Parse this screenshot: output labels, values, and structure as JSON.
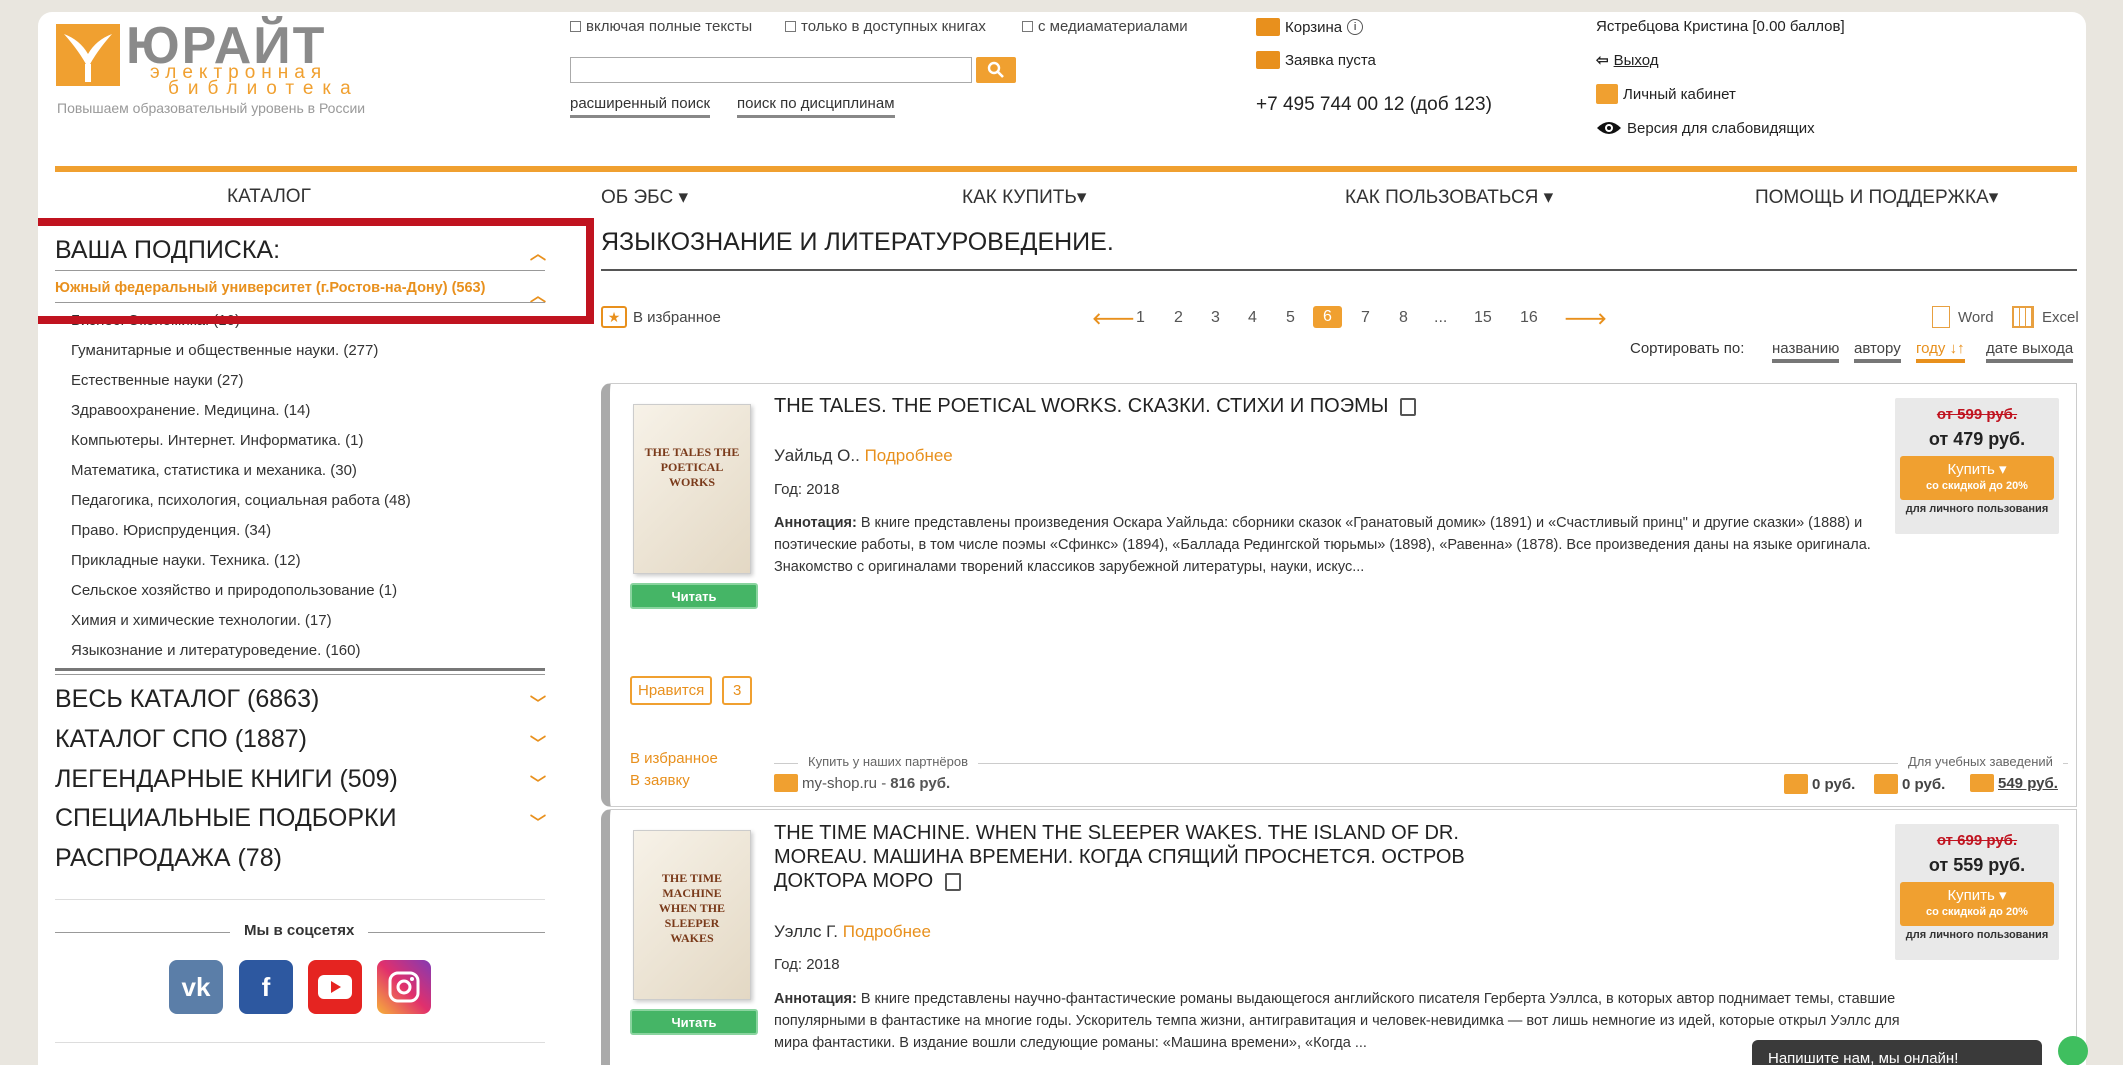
{
  "logo": {
    "main": "ЮРАЙТ",
    "sub1": "электронная",
    "sub2": "библиотека",
    "slogan": "Повышаем образовательный уровень в России"
  },
  "search": {
    "options": [
      "включая полные тексты",
      "только в доступных книгах",
      "с медиаматериалами"
    ],
    "placeholder": "",
    "advanced": "расширенный поиск",
    "by_disciplines": "поиск по дисциплинам"
  },
  "cart": {
    "label": "Корзина",
    "request": "Заявка пуста",
    "phone": "+7 495 744 00 12 (доб 123)"
  },
  "user": {
    "name": "Ястребцова Кристина [0.00 баллов]",
    "logout": "Выход",
    "cabinet": "Личный кабинет",
    "accessibility": "Версия для слабовидящих"
  },
  "nav": [
    "КАТАЛОГ",
    "ОБ ЭБС",
    "КАК КУПИТЬ",
    "КАК ПОЛЬЗОВАТЬСЯ",
    "ПОМОЩЬ И ПОДДЕРЖКА"
  ],
  "sidebar": {
    "subscription_title": "ВАША ПОДПИСКА:",
    "university": "Южный федеральный университет (г.Ростов-на-Дону) (563)",
    "items": [
      "Бизнес. Экономика. (10)",
      "Гуманитарные и общественные науки. (277)",
      "Естественные науки (27)",
      "Здравоохранение. Медицина. (14)",
      "Компьютеры. Интернет. Информатика. (1)",
      "Математика, статистика и механика. (30)",
      "Педагогика, психология, социальная работа (48)",
      "Право. Юриспруденция. (34)",
      "Прикладные науки. Техника. (12)",
      "Сельское хозяйство и природопользование (1)",
      "Химия и химические технологии. (17)",
      "Языкознание и литературоведение. (160)"
    ],
    "sections": [
      "ВЕСЬ КАТАЛОГ (6863)",
      "КАТАЛОГ СПО (1887)",
      "ЛЕГЕНДАРНЫЕ КНИГИ (509)",
      "СПЕЦИАЛЬНЫЕ ПОДБОРКИ",
      "РАСПРОДАЖА (78)"
    ],
    "social_title": "Мы в соцсетях"
  },
  "main": {
    "title": "ЯЗЫКОЗНАНИЕ И ЛИТЕРАТУРОВЕДЕНИЕ.",
    "favorites": "В избранное",
    "pages": [
      "1",
      "2",
      "3",
      "4",
      "5",
      "6",
      "7",
      "8",
      "...",
      "15",
      "16"
    ],
    "active_page": "6",
    "export_word": "Word",
    "export_excel": "Excel",
    "sort_label": "Сортировать по:",
    "sort_options": [
      "названию",
      "автору",
      "году",
      "дате выхода"
    ]
  },
  "books": [
    {
      "title": "THE TALES. THE POETICAL WORKS. СКАЗКИ. СТИХИ И ПОЭМЫ",
      "author": "Уайльд О..",
      "more": "Подробнее",
      "year": "Год: 2018",
      "annot_label": "Аннотация:",
      "annot": "В книге представлены произведения Оскара Уайльда: сборники сказок «Гранатовый домик» (1891) и «Счастливый принц\" и другие сказки» (1888) и поэтические работы, в том числе поэмы «Сфинкс» (1894), «Баллада Редингской тюрьмы» (1898), «Равенна» (1878). Все произведения даны на языке оригинала. Знакомство с оригиналами творений классиков зарубежной литературы, науки, искус...",
      "old_price": "от 599 руб.",
      "price": "от 479 руб.",
      "buy": "Купить ▾",
      "discount": "со скидкой до 20%",
      "personal": "для личного пользования",
      "read": "Читать",
      "like": "Нравится",
      "likes": "3",
      "to_fav": "В избранное",
      "to_request": "В заявку",
      "partners": "Купить у наших партнёров",
      "shop": "my-shop.ru -",
      "shop_price": "816 руб.",
      "institutions": "Для учебных заведений",
      "p1": "0 руб.",
      "p2": "0 руб.",
      "p3": "549 руб.",
      "cover_text": "THE TALES THE POETICAL WORKS"
    },
    {
      "title": "THE TIME MACHINE. WHEN THE SLEEPER WAKES. THE ISLAND OF DR. MOREAU. МАШИНА ВРЕМЕНИ. КОГДА СПЯЩИЙ ПРОСНЕТСЯ. ОСТРОВ ДОКТОРА МОРО",
      "author": "Уэллс Г.",
      "more": "Подробнее",
      "year": "Год: 2018",
      "annot_label": "Аннотация:",
      "annot": "В книге представлены научно-фантастические романы выдающегося английского писателя Герберта Уэллса, в которых автор поднимает темы, ставшие популярными в фантастике на многие годы. Ускоритель темпа жизни, антигравитация и человек-невидимка — вот лишь немногие из идей, которые открыл Уэллс для мира фантастики. В издание вошли следующие романы: «Машина времени», «Когда ...",
      "old_price": "от 699 руб.",
      "price": "от 559 руб.",
      "buy": "Купить ▾",
      "discount": "со скидкой до 20%",
      "personal": "для личного пользования",
      "read": "Читать",
      "cover_text": "THE TIME MACHINE WHEN THE SLEEPER WAKES"
    }
  ],
  "chat": "Напишите нам, мы онлайн!"
}
